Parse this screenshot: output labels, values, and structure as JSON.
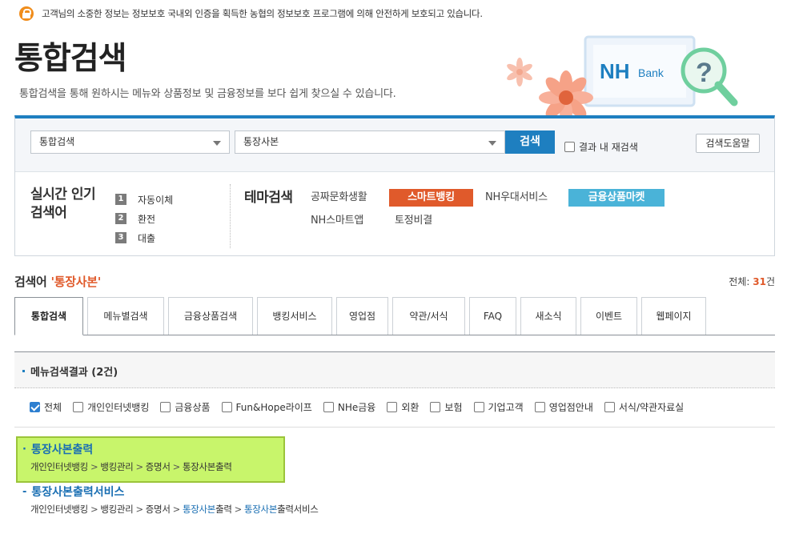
{
  "notice": "고객님의 소중한 정보는 정보보호 국내외 인증을 획득한 농협의 정보보호 프로그램에 의해 안전하게 보호되고 있습니다.",
  "page": {
    "title": "통합검색",
    "subtitle": "통합검색을 통해 원하시는 메뉴와 상품정보 및 금융정보를 보다 쉽게 찾으실 수 있습니다.",
    "hero_brand": "NH",
    "hero_brand_sub": "Bank"
  },
  "search": {
    "category": "통합검색",
    "query": "통장사본",
    "search_label": "검색",
    "research_label": "결과 내 재검색",
    "help_label": "검색도움말"
  },
  "popular": {
    "title_line1": "실시간 인기",
    "title_line2": "검색어",
    "items": [
      {
        "num": "1",
        "label": "자동이체"
      },
      {
        "num": "2",
        "label": "환전"
      },
      {
        "num": "3",
        "label": "대출"
      }
    ]
  },
  "theme": {
    "title": "테마검색",
    "items": [
      "공짜문화생활",
      "스마트뱅킹",
      "NH우대서비스",
      "금융상품마켓",
      "NH스마트앱",
      "토정비결"
    ]
  },
  "result_header": {
    "label": "검색어",
    "query": "'통장사본'",
    "total_label": "전체:",
    "total_count": "31",
    "total_unit": "건"
  },
  "tabs": [
    "통합검색",
    "메뉴별검색",
    "금융상품검색",
    "뱅킹서비스",
    "영업점",
    "약관/서식",
    "FAQ",
    "새소식",
    "이벤트",
    "웹페이지"
  ],
  "menu_section": {
    "title": "메뉴검색결과 (2건)"
  },
  "filters": [
    "전체",
    "개인인터넷뱅킹",
    "금융상품",
    "Fun&Hope라이프",
    "NHe금융",
    "외환",
    "보험",
    "기업고객",
    "영업점안내",
    "서식/약관자료실"
  ],
  "results": [
    {
      "title_hi": "통장사본",
      "title_rest": "출력",
      "path": [
        "개인인터넷뱅킹",
        "뱅킹관리",
        "증명서",
        "통장사본출력"
      ]
    },
    {
      "title_hi": "통장사본",
      "title_rest": "출력서비스",
      "path": [
        "개인인터넷뱅킹",
        "뱅킹관리",
        "증명서",
        "통장사본",
        "출력",
        "통장사본",
        "출력서비스"
      ]
    }
  ],
  "colors": {
    "accent": "#1e7fc0",
    "highlight": "#e05a2b",
    "theme_blue": "#4ab3d8",
    "result_highlight": "#c8f56b"
  }
}
